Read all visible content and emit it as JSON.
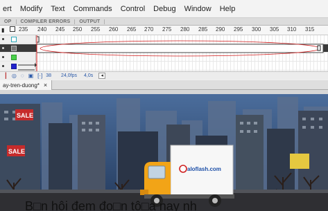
{
  "menu": [
    "ert",
    "Modify",
    "Text",
    "Commands",
    "Control",
    "Debug",
    "Window",
    "Help"
  ],
  "panel_tabs": [
    "OP",
    "COMPILER ERRORS",
    "OUTPUT"
  ],
  "ruler": [
    "235",
    "240",
    "245",
    "250",
    "255",
    "260",
    "265",
    "270",
    "275",
    "280",
    "285",
    "290",
    "295",
    "300",
    "305",
    "310",
    "315"
  ],
  "status": {
    "frame": "38",
    "fps": "24,0fps",
    "time": "4,0s"
  },
  "document": {
    "tab_label": "ay-tren-duong*",
    "close": "×"
  },
  "stage": {
    "sale_sign": "SALE",
    "sale_sign_2": "SALE",
    "truck_text": "aloflash.com",
    "caption": "B□n hôi đem đo□n tô□a nay nh"
  },
  "colors": {
    "sky": "#344f78",
    "road": "#2f2f33",
    "truck_cab": "#f2a417",
    "cargo": "#f7f7f7",
    "accent_blue": "#1d4fa8"
  }
}
